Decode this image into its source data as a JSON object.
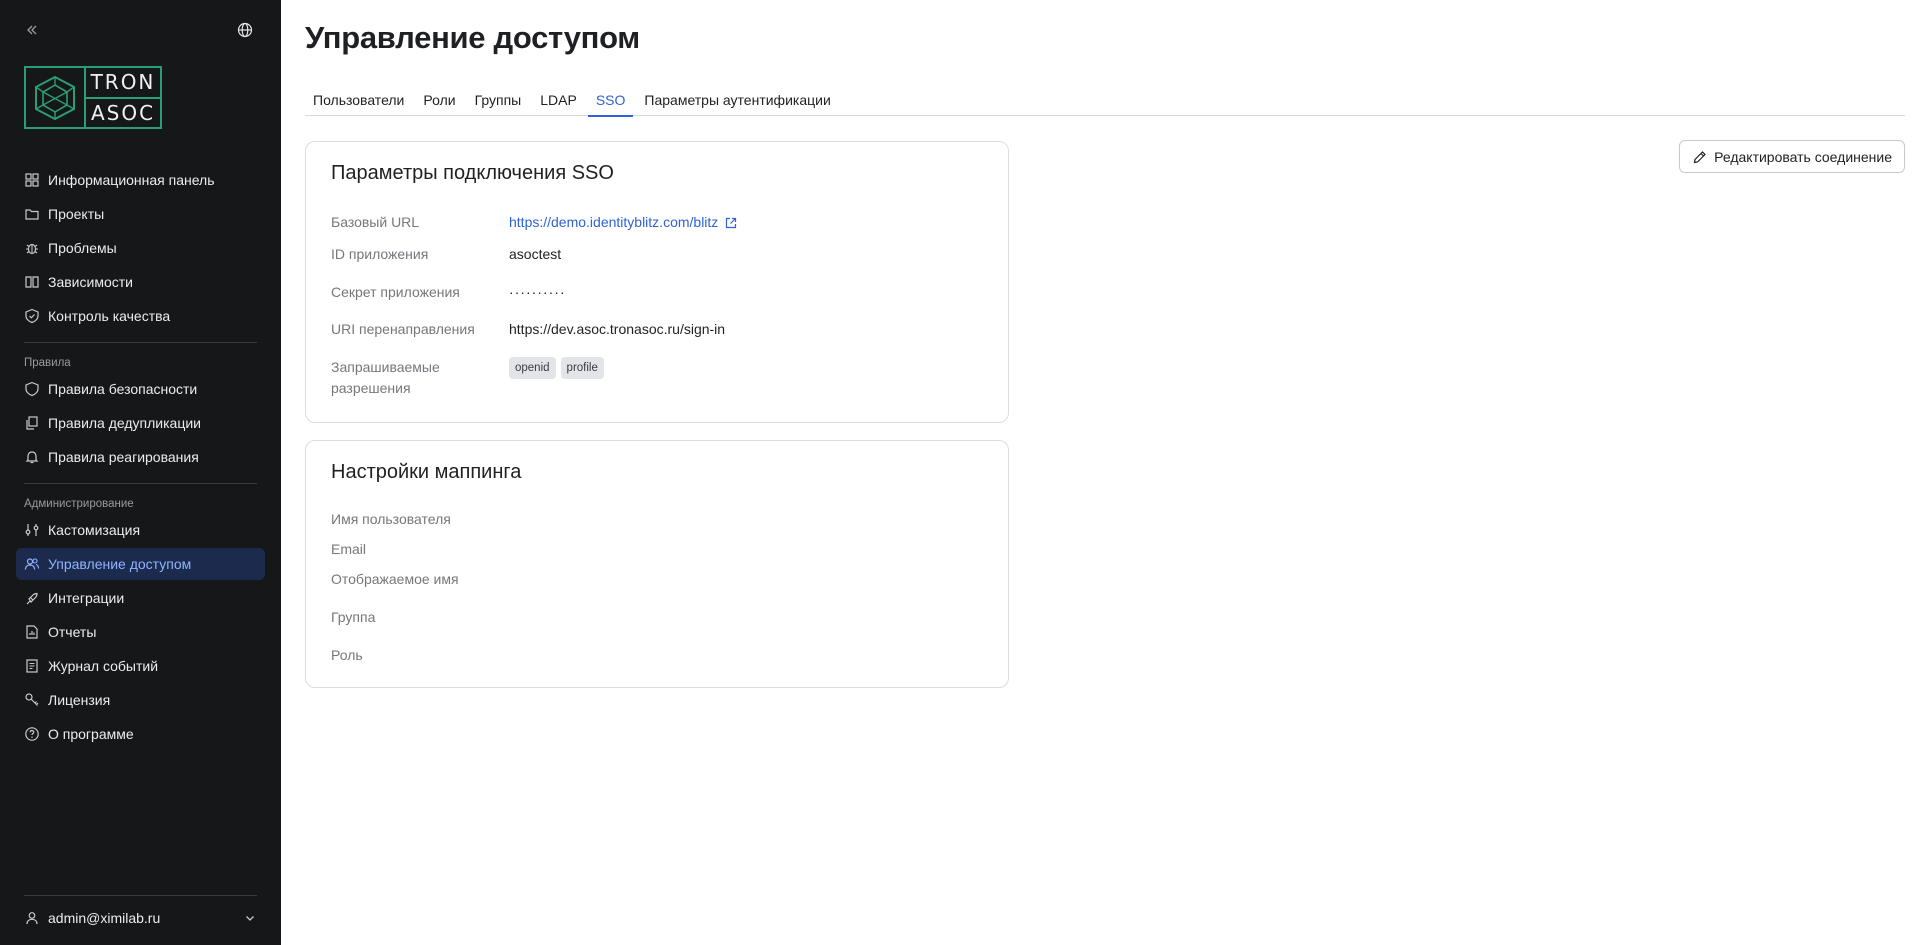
{
  "app": {
    "brand_line1": "TRON",
    "brand_line2": "ASOC"
  },
  "sidebar": {
    "nav_main": [
      {
        "label": "Информационная панель",
        "icon": "dashboard-icon"
      },
      {
        "label": "Проекты",
        "icon": "folder-icon"
      },
      {
        "label": "Проблемы",
        "icon": "bug-icon"
      },
      {
        "label": "Зависимости",
        "icon": "book-icon"
      },
      {
        "label": "Контроль качества",
        "icon": "shield-check-icon"
      }
    ],
    "section_rules": "Правила",
    "nav_rules": [
      {
        "label": "Правила безопасности",
        "icon": "shield-icon"
      },
      {
        "label": "Правила дедупликации",
        "icon": "copy-icon"
      },
      {
        "label": "Правила реагирования",
        "icon": "bell-icon"
      }
    ],
    "section_admin": "Администрирование",
    "nav_admin": [
      {
        "label": "Кастомизация",
        "icon": "sliders-icon"
      },
      {
        "label": "Управление доступом",
        "icon": "users-icon",
        "active": true
      },
      {
        "label": "Интеграции",
        "icon": "plug-icon"
      },
      {
        "label": "Отчеты",
        "icon": "report-icon"
      },
      {
        "label": "Журнал событий",
        "icon": "log-icon"
      },
      {
        "label": "Лицензия",
        "icon": "key-icon"
      },
      {
        "label": "О программе",
        "icon": "help-icon"
      }
    ],
    "user": "admin@ximilab.ru"
  },
  "main": {
    "title": "Управление доступом",
    "tabs": [
      {
        "label": "Пользователи"
      },
      {
        "label": "Роли"
      },
      {
        "label": "Группы"
      },
      {
        "label": "LDAP"
      },
      {
        "label": "SSO",
        "active": true
      },
      {
        "label": "Параметры аутентификации"
      }
    ],
    "edit_button": "Редактировать соединение",
    "sso_card": {
      "title": "Параметры подключения SSO",
      "base_url_label": "Базовый URL",
      "base_url_value": "https://demo.identityblitz.com/blitz",
      "app_id_label": "ID приложения",
      "app_id_value": "asoctest",
      "secret_label": "Секрет приложения",
      "secret_value": "··········",
      "redirect_label": "URI перенаправления",
      "redirect_value": "https://dev.asoc.tronasoc.ru/sign-in",
      "scopes_label_line1": "Запрашиваемые",
      "scopes_label_line2": "разрешения",
      "scopes": [
        "openid",
        "profile"
      ]
    },
    "mapping_card": {
      "title": "Настройки маппинга",
      "username_label": "Имя пользователя",
      "email_label": "Email",
      "display_name_label": "Отображаемое имя",
      "group_label": "Группа",
      "role_label": "Роль"
    }
  },
  "colors": {
    "sidebar_bg": "#161719",
    "accent": "#2f62d6",
    "brand_green": "#2a9d74",
    "active_nav_bg": "#1c2a4d"
  }
}
